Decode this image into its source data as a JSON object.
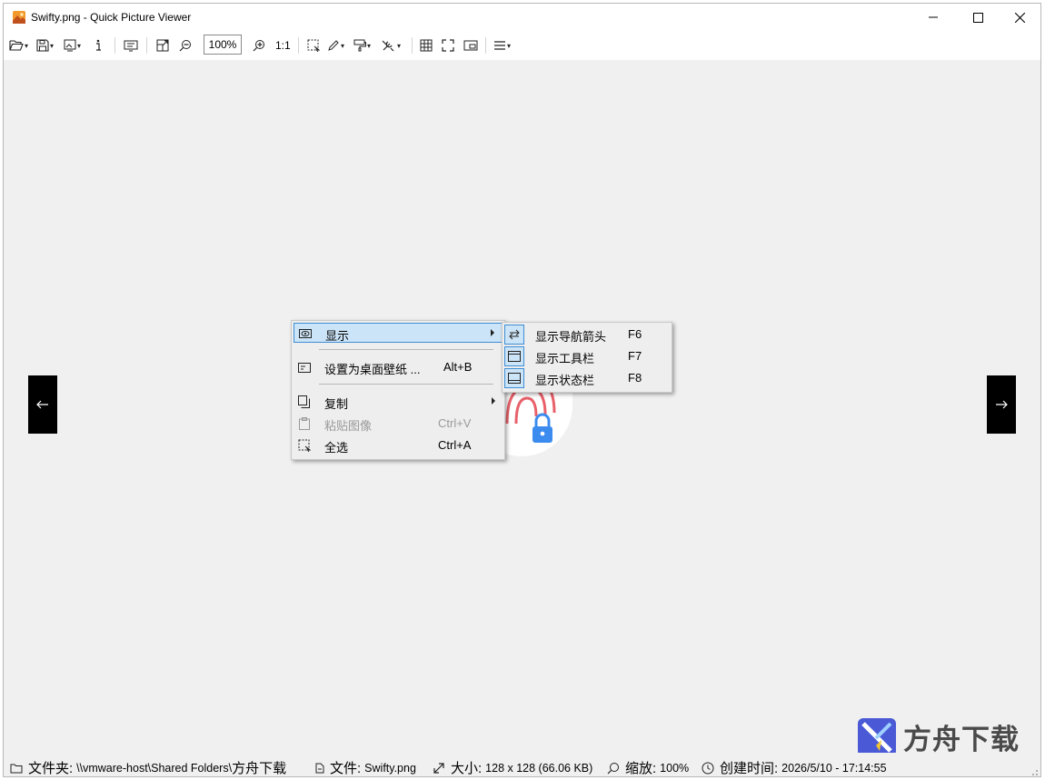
{
  "window": {
    "title": "Swifty.png - Quick Picture Viewer",
    "controls": {
      "minimize": "minimize",
      "maximize": "maximize",
      "close": "close"
    }
  },
  "toolbar": {
    "zoom_value": "100%",
    "actual_size_label": "1:1",
    "icons": [
      "open-folder-icon",
      "save-icon",
      "wallpaper-icon",
      "info-icon",
      "slideshow-icon",
      "fit-icon",
      "zoom-out-icon",
      "zoom-in-icon",
      "select-icon",
      "draw-icon",
      "paint-icon",
      "tools-icon",
      "grid-icon",
      "fullscreen-icon",
      "picture-in-picture-icon",
      "menu-icon"
    ]
  },
  "context_menu": {
    "items": [
      {
        "label": "显示",
        "shortcut": "",
        "icon": "eye-icon",
        "submenu": true,
        "disabled": false
      },
      {
        "label": "设置为桌面壁纸 ...",
        "shortcut": "Alt+B",
        "icon": "wallpaper-icon",
        "submenu": false,
        "disabled": false
      },
      {
        "label": "复制",
        "shortcut": "",
        "icon": "copy-icon",
        "submenu": true,
        "disabled": false
      },
      {
        "label": "粘贴图像",
        "shortcut": "Ctrl+V",
        "icon": "paste-icon",
        "submenu": false,
        "disabled": true
      },
      {
        "label": "全选",
        "shortcut": "Ctrl+A",
        "icon": "select-all-icon",
        "submenu": false,
        "disabled": false
      }
    ]
  },
  "submenu": {
    "items": [
      {
        "label": "显示导航箭头",
        "shortcut": "F6",
        "icon": "swap-arrows-icon"
      },
      {
        "label": "显示工具栏",
        "shortcut": "F7",
        "icon": "toolbar-window-icon"
      },
      {
        "label": "显示状态栏",
        "shortcut": "F8",
        "icon": "statusbar-window-icon"
      }
    ]
  },
  "statusbar": {
    "folder_label": "文件夹:",
    "folder_value": "\\\\vmware-host\\Shared Folders\\",
    "folder_tail": "方舟下载",
    "file_label": "文件:",
    "file_value": "Swifty.png",
    "size_label": "大小:",
    "size_value": "128 x 128 (66.06 KB)",
    "zoom_label": "缩放:",
    "zoom_value": "100%",
    "created_label": "创建时间:",
    "created_value": "2026/5/10 - 17:14:55"
  },
  "watermark": {
    "text": "方舟下载"
  },
  "colors": {
    "highlight_bg": "#cce4f7",
    "highlight_border": "#3d8dd4",
    "canvas": "#f0f0f0",
    "fingerprint": "#e8606a",
    "lock": "#3c8cf0"
  }
}
